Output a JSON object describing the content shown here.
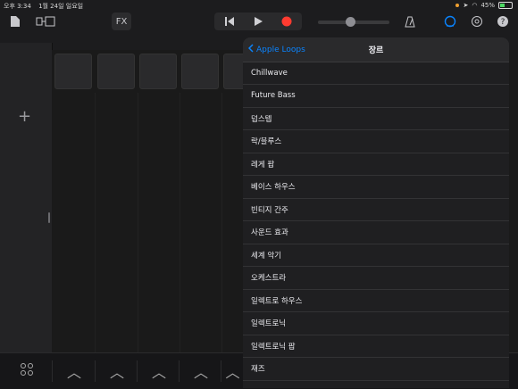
{
  "status_bar": {
    "time": "오후 3:34",
    "date": "1월 24일 일요일",
    "battery": "45%",
    "battery_fraction": 0.45
  },
  "toolbar": {
    "fx_label": "FX",
    "master_volume": 0.45
  },
  "popover": {
    "back_label": "Apple Loops",
    "title": "장르",
    "genres": [
      "Chillwave",
      "Future Bass",
      "덥스텝",
      "락/블루스",
      "레게 팝",
      "베이스 하우스",
      "빈티지 간주",
      "사운드 효과",
      "세계 악기",
      "오케스트라",
      "일렉트로 하우스",
      "일렉트로닉",
      "일렉트로닉 팝",
      "재즈"
    ]
  },
  "colors": {
    "accent": "#0a84ff",
    "record": "#ff3b30",
    "background": "#1c1c1e"
  }
}
